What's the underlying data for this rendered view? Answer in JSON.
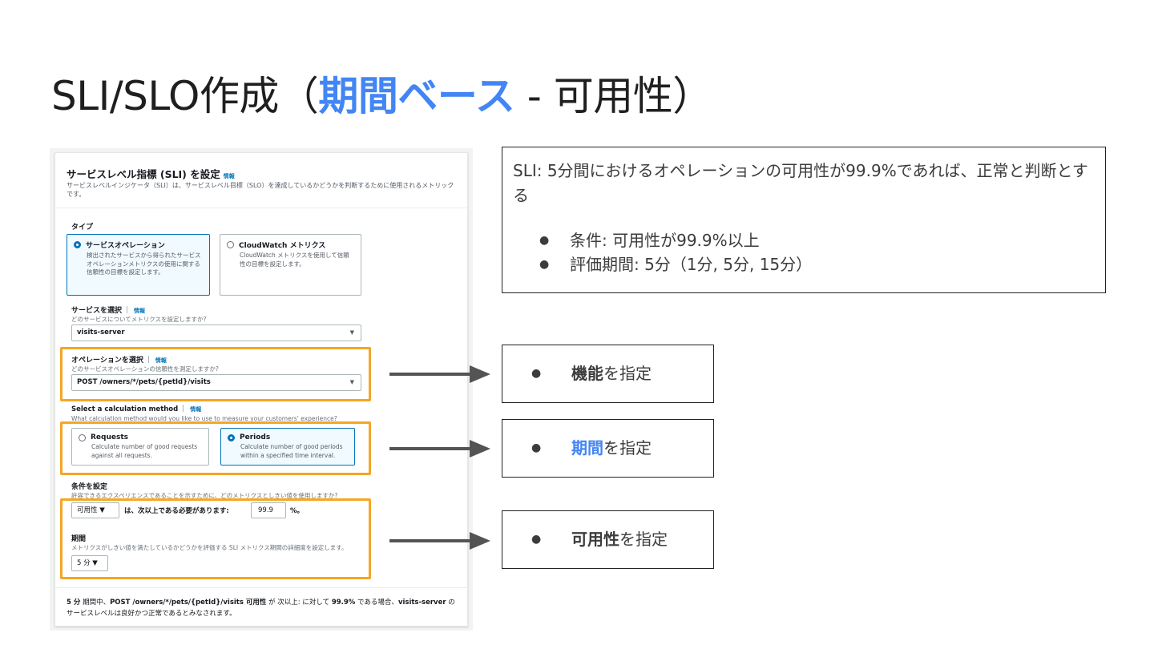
{
  "slide": {
    "title_prefix": "SLI/SLO作成（",
    "title_highlight": "期間ベース",
    "title_suffix": " - 可用性）",
    "highlight_color": "#4285f4"
  },
  "console": {
    "header": {
      "title": "サービスレベル指標 (SLI) を設定",
      "info": "情報",
      "description": "サービスレベルインジケータ（SLI）は、サービスレベル目標（SLO）を達成しているかどうかを判断するために使用されるメトリックです。"
    },
    "type": {
      "label": "タイプ",
      "options": [
        {
          "title": "サービスオペレーション",
          "description": "検出されたサービスから得られたサービスオペレーションメトリクスの使用に関する信頼性の目標を設定します。",
          "selected": true
        },
        {
          "title": "CloudWatch メトリクス",
          "description": "CloudWatch メトリクスを使用して信頼性の目標を設定します。",
          "selected": false
        }
      ]
    },
    "service": {
      "label": "サービスを選択",
      "info": "情報",
      "help": "どのサービスについてメトリクスを設定しますか?",
      "value": "visits-server"
    },
    "operation": {
      "label": "オペレーションを選択",
      "info": "情報",
      "help": "どのサービスオペレーションの信頼性を測定しますか?",
      "value": "POST /owners/*/pets/{petId}/visits"
    },
    "calc": {
      "label": "Select a calculation method",
      "info": "情報",
      "help": "What calculation method would you like to use to measure your customers' experience?",
      "options": [
        {
          "title": "Requests",
          "description": "Calculate number of good requests against all requests.",
          "selected": false
        },
        {
          "title": "Periods",
          "description": "Calculate number of good periods within a specified time interval.",
          "selected": true
        }
      ]
    },
    "condition": {
      "label": "条件を設定",
      "help": "許容できるエクスペリエンスであることを示すために、どのメトリクスとしきい値を使用しますか?",
      "metric": "可用性 ▼",
      "text": "は、次以上である必要があります:",
      "threshold": "99.9",
      "unit": "%。"
    },
    "period": {
      "label": "期間",
      "help": "メトリクスがしきい値を満たしているかどうかを評価する SLI メトリクス期間の詳細度を設定します。",
      "value": "5 分 ▼"
    },
    "summary": {
      "p1": "5 分",
      "p2": " 期間中、",
      "p3": "POST /owners/*/pets/{petId}/visits 可用性",
      "p4": " が 次以上: に対して ",
      "p5": "99.9%",
      "p6": " である場合、",
      "p7": "visits-server",
      "p8": " のサービスレベルは良好かつ正常であるとみなされます。"
    }
  },
  "sli_box": {
    "description": "SLI: 5分間におけるオペレーションの可用性が99.9%であれば、正常と判断とする",
    "bullets": [
      "条件: 可用性が99.9%以上",
      "評価期間: 5分（1分, 5分, 15分）"
    ]
  },
  "callouts": [
    {
      "strong": "機能",
      "rest": "を指定"
    },
    {
      "strong": "期間",
      "rest": "を指定"
    },
    {
      "strong": "可用性",
      "rest": "を指定"
    }
  ]
}
